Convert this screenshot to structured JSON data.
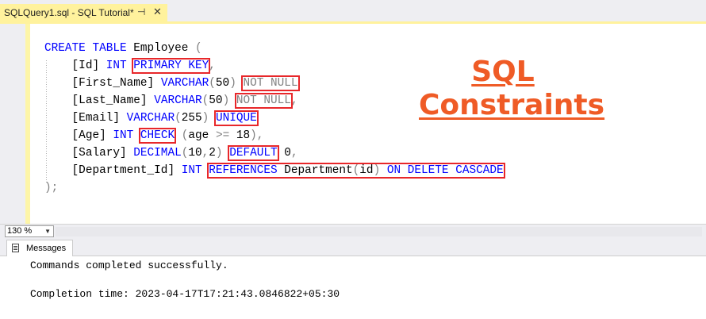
{
  "tab": {
    "title": "SQLQuery1.sql - SQL Tutorial*",
    "pin_glyph": "⊣",
    "close_glyph": "✕"
  },
  "editor": {
    "lines": [
      [
        {
          "t": "CREATE TABLE",
          "c": "kw"
        },
        {
          "t": " Employee "
        },
        {
          "t": "(",
          "c": "gray"
        }
      ],
      [
        {
          "t": "    [Id] "
        },
        {
          "t": "INT",
          "c": "kw"
        },
        {
          "t": " "
        },
        {
          "t": "PRIMARY KEY",
          "c": "kw",
          "box": true
        },
        {
          "t": ",",
          "c": "gray"
        }
      ],
      [
        {
          "t": "    [First_Name] "
        },
        {
          "t": "VARCHAR",
          "c": "kw"
        },
        {
          "t": "(",
          "c": "gray"
        },
        {
          "t": "50"
        },
        {
          "t": ")",
          "c": "gray"
        },
        {
          "t": " "
        },
        {
          "t": "NOT NULL",
          "c": "gray",
          "box": true
        }
      ],
      [
        {
          "t": "    [Last_Name] "
        },
        {
          "t": "VARCHAR",
          "c": "kw"
        },
        {
          "t": "(",
          "c": "gray"
        },
        {
          "t": "50"
        },
        {
          "t": ")",
          "c": "gray"
        },
        {
          "t": " "
        },
        {
          "t": "NOT NULL",
          "c": "gray",
          "box": true
        },
        {
          "t": ",",
          "c": "gray"
        }
      ],
      [
        {
          "t": "    [Email] "
        },
        {
          "t": "VARCHAR",
          "c": "kw"
        },
        {
          "t": "(",
          "c": "gray"
        },
        {
          "t": "255"
        },
        {
          "t": ")",
          "c": "gray"
        },
        {
          "t": " "
        },
        {
          "t": "UNIQUE",
          "c": "kw",
          "box": true
        }
      ],
      [
        {
          "t": "    [Age] "
        },
        {
          "t": "INT",
          "c": "kw"
        },
        {
          "t": " "
        },
        {
          "t": "CHECK",
          "c": "kw",
          "box": true
        },
        {
          "t": " "
        },
        {
          "t": "(",
          "c": "gray"
        },
        {
          "t": "age "
        },
        {
          "t": ">=",
          "c": "gray"
        },
        {
          "t": " 18"
        },
        {
          "t": "),",
          "c": "gray"
        }
      ],
      [
        {
          "t": "    [Salary] "
        },
        {
          "t": "DECIMAL",
          "c": "kw"
        },
        {
          "t": "(",
          "c": "gray"
        },
        {
          "t": "10"
        },
        {
          "t": ",",
          "c": "gray"
        },
        {
          "t": "2"
        },
        {
          "t": ")",
          "c": "gray"
        },
        {
          "t": " "
        },
        {
          "t": "DEFAULT",
          "c": "kw",
          "box": true
        },
        {
          "t": " 0"
        },
        {
          "t": ",",
          "c": "gray"
        }
      ],
      [
        {
          "t": "    [Department_Id] "
        },
        {
          "t": "INT",
          "c": "kw"
        },
        {
          "t": " "
        },
        {
          "t": "REFERENCES",
          "c": "kw",
          "box": true,
          "group": "ref"
        },
        {
          "t": " Department",
          "box": true,
          "group": "ref"
        },
        {
          "t": "(",
          "c": "gray",
          "group": "ref"
        },
        {
          "t": "id",
          "group": "ref"
        },
        {
          "t": ")",
          "c": "gray",
          "group": "ref"
        },
        {
          "t": " ON DELETE CASCADE",
          "c": "kw",
          "group": "ref"
        }
      ],
      [
        {
          "t": ");",
          "c": "gray"
        }
      ]
    ]
  },
  "badge": {
    "line1": "SQL",
    "line2": "Constraints",
    "color": "#ef5b26"
  },
  "zoom": {
    "value": "130 %"
  },
  "results": {
    "tab_label": "Messages",
    "line1": "Commands completed successfully.",
    "line2": "Completion time: 2023-04-17T17:21:43.0846822+05:30"
  }
}
